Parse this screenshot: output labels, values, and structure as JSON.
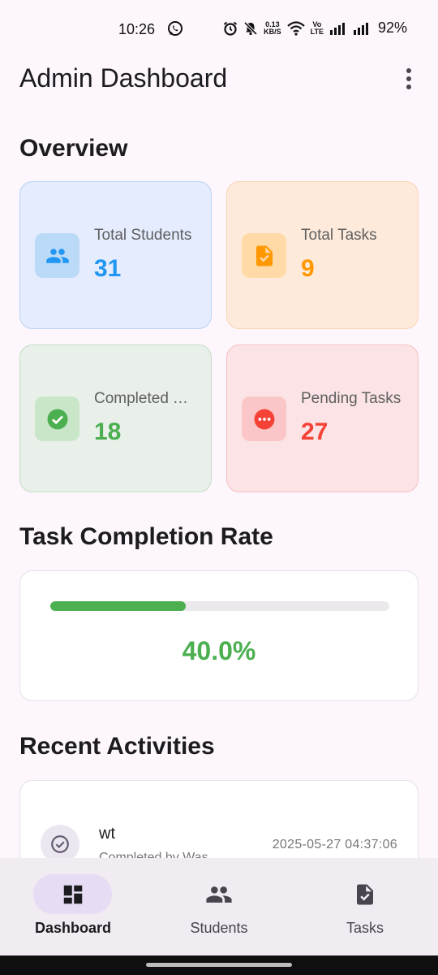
{
  "status_bar": {
    "time": "10:26",
    "data_rate_top": "0.13",
    "data_rate_bottom": "KB/S",
    "volte_top": "Vo",
    "volte_bottom": "LTE",
    "battery": "92%"
  },
  "app_bar": {
    "title": "Admin Dashboard"
  },
  "overview": {
    "title": "Overview",
    "cards": [
      {
        "label": "Total Students",
        "value": "31",
        "color": "#2196f3",
        "icon": "people-icon"
      },
      {
        "label": "Total Tasks",
        "value": "9",
        "color": "#ff9800",
        "icon": "task-file-icon"
      },
      {
        "label": "Completed Tasks",
        "value": "18",
        "color": "#4caf50",
        "icon": "check-circle-icon"
      },
      {
        "label": "Pending Tasks",
        "value": "27",
        "color": "#f44336",
        "icon": "pending-icon"
      }
    ]
  },
  "completion": {
    "title": "Task Completion Rate",
    "rate_fraction": 0.4,
    "rate_text": "40.0%",
    "color": "#4caf50"
  },
  "activities": {
    "title": "Recent Activities",
    "items": [
      {
        "title": "wt",
        "subtitle": "Completed by Was...",
        "timestamp": "2025-05-27 04:37:06",
        "icon": "check-circle-outline-icon"
      }
    ]
  },
  "bottom_nav": {
    "items": [
      {
        "label": "Dashboard",
        "icon": "dashboard-icon",
        "active": true
      },
      {
        "label": "Students",
        "icon": "people-icon",
        "active": false
      },
      {
        "label": "Tasks",
        "icon": "task-file-icon",
        "active": false
      }
    ]
  }
}
